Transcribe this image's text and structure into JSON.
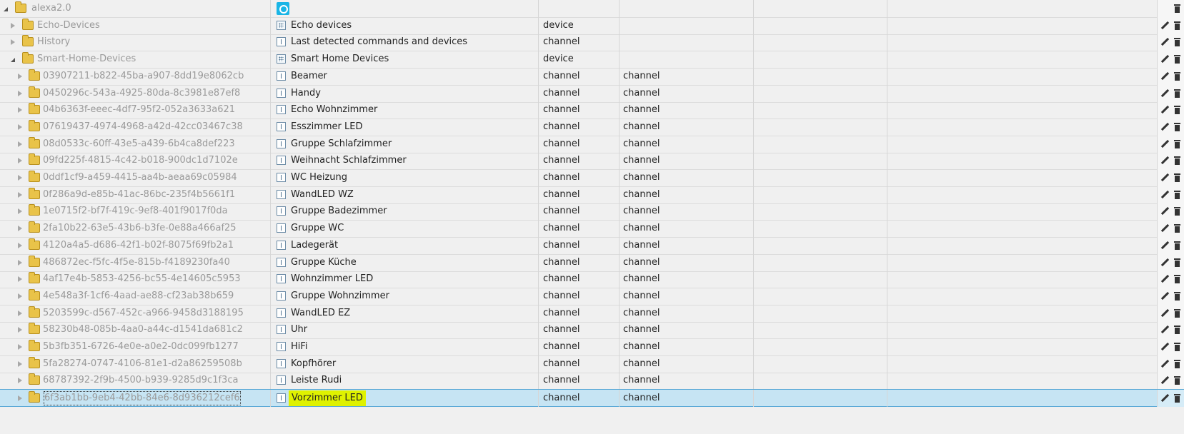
{
  "tree": {
    "rows": [
      {
        "id": "alexa2.0",
        "name": "",
        "icon": "echo-icon",
        "type": "",
        "role": "",
        "depth": 0,
        "expanded": true,
        "selected": false,
        "highlight": false,
        "actions": false
      },
      {
        "id": "Echo-Devices",
        "name": "Echo devices",
        "icon": "device-icon",
        "type": "device",
        "role": "",
        "depth": 1,
        "expanded": false,
        "selected": false,
        "highlight": false,
        "actions": true
      },
      {
        "id": "History",
        "name": "Last detected commands and devices",
        "icon": "channel-icon",
        "type": "channel",
        "role": "",
        "depth": 1,
        "expanded": false,
        "selected": false,
        "highlight": false,
        "actions": true
      },
      {
        "id": "Smart-Home-Devices",
        "name": "Smart Home Devices",
        "icon": "device-icon",
        "type": "device",
        "role": "",
        "depth": 1,
        "expanded": true,
        "selected": false,
        "highlight": false,
        "actions": true
      },
      {
        "id": "03907211-b822-45ba-a907-8dd19e8062cb",
        "name": "Beamer",
        "icon": "channel-icon",
        "type": "channel",
        "role": "channel",
        "depth": 2,
        "expanded": false,
        "selected": false,
        "highlight": false,
        "actions": true
      },
      {
        "id": "0450296c-543a-4925-80da-8c3981e87ef8",
        "name": "Handy",
        "icon": "channel-icon",
        "type": "channel",
        "role": "channel",
        "depth": 2,
        "expanded": false,
        "selected": false,
        "highlight": false,
        "actions": true
      },
      {
        "id": "04b6363f-eeec-4df7-95f2-052a3633a621",
        "name": "Echo Wohnzimmer",
        "icon": "channel-icon",
        "type": "channel",
        "role": "channel",
        "depth": 2,
        "expanded": false,
        "selected": false,
        "highlight": false,
        "actions": true
      },
      {
        "id": "07619437-4974-4968-a42d-42cc03467c38",
        "name": "Esszimmer LED",
        "icon": "channel-icon",
        "type": "channel",
        "role": "channel",
        "depth": 2,
        "expanded": false,
        "selected": false,
        "highlight": false,
        "actions": true
      },
      {
        "id": "08d0533c-60ff-43e5-a439-6b4ca8def223",
        "name": "Gruppe Schlafzimmer",
        "icon": "channel-icon",
        "type": "channel",
        "role": "channel",
        "depth": 2,
        "expanded": false,
        "selected": false,
        "highlight": false,
        "actions": true
      },
      {
        "id": "09fd225f-4815-4c42-b018-900dc1d7102e",
        "name": "Weihnacht Schlafzimmer",
        "icon": "channel-icon",
        "type": "channel",
        "role": "channel",
        "depth": 2,
        "expanded": false,
        "selected": false,
        "highlight": false,
        "actions": true
      },
      {
        "id": "0ddf1cf9-a459-4415-aa4b-aeaa69c05984",
        "name": "WC Heizung",
        "icon": "channel-icon",
        "type": "channel",
        "role": "channel",
        "depth": 2,
        "expanded": false,
        "selected": false,
        "highlight": false,
        "actions": true
      },
      {
        "id": "0f286a9d-e85b-41ac-86bc-235f4b5661f1",
        "name": "WandLED WZ",
        "icon": "channel-icon",
        "type": "channel",
        "role": "channel",
        "depth": 2,
        "expanded": false,
        "selected": false,
        "highlight": false,
        "actions": true
      },
      {
        "id": "1e0715f2-bf7f-419c-9ef8-401f9017f0da",
        "name": "Gruppe Badezimmer",
        "icon": "channel-icon",
        "type": "channel",
        "role": "channel",
        "depth": 2,
        "expanded": false,
        "selected": false,
        "highlight": false,
        "actions": true
      },
      {
        "id": "2fa10b22-63e5-43b6-b3fe-0e88a466af25",
        "name": "Gruppe WC",
        "icon": "channel-icon",
        "type": "channel",
        "role": "channel",
        "depth": 2,
        "expanded": false,
        "selected": false,
        "highlight": false,
        "actions": true
      },
      {
        "id": "4120a4a5-d686-42f1-b02f-8075f69fb2a1",
        "name": "Ladegerät",
        "icon": "channel-icon",
        "type": "channel",
        "role": "channel",
        "depth": 2,
        "expanded": false,
        "selected": false,
        "highlight": false,
        "actions": true
      },
      {
        "id": "486872ec-f5fc-4f5e-815b-f4189230fa40",
        "name": "Gruppe Küche",
        "icon": "channel-icon",
        "type": "channel",
        "role": "channel",
        "depth": 2,
        "expanded": false,
        "selected": false,
        "highlight": false,
        "actions": true
      },
      {
        "id": "4af17e4b-5853-4256-bc55-4e14605c5953",
        "name": "Wohnzimmer LED",
        "icon": "channel-icon",
        "type": "channel",
        "role": "channel",
        "depth": 2,
        "expanded": false,
        "selected": false,
        "highlight": false,
        "actions": true
      },
      {
        "id": "4e548a3f-1cf6-4aad-ae88-cf23ab38b659",
        "name": "Gruppe Wohnzimmer",
        "icon": "channel-icon",
        "type": "channel",
        "role": "channel",
        "depth": 2,
        "expanded": false,
        "selected": false,
        "highlight": false,
        "actions": true
      },
      {
        "id": "5203599c-d567-452c-a966-9458d3188195",
        "name": "WandLED EZ",
        "icon": "channel-icon",
        "type": "channel",
        "role": "channel",
        "depth": 2,
        "expanded": false,
        "selected": false,
        "highlight": false,
        "actions": true
      },
      {
        "id": "58230b48-085b-4aa0-a44c-d1541da681c2",
        "name": "Uhr",
        "icon": "channel-icon",
        "type": "channel",
        "role": "channel",
        "depth": 2,
        "expanded": false,
        "selected": false,
        "highlight": false,
        "actions": true
      },
      {
        "id": "5b3fb351-6726-4e0e-a0e2-0dc099fb1277",
        "name": "HiFi",
        "icon": "channel-icon",
        "type": "channel",
        "role": "channel",
        "depth": 2,
        "expanded": false,
        "selected": false,
        "highlight": false,
        "actions": true
      },
      {
        "id": "5fa28274-0747-4106-81e1-d2a86259508b",
        "name": "Kopfhörer",
        "icon": "channel-icon",
        "type": "channel",
        "role": "channel",
        "depth": 2,
        "expanded": false,
        "selected": false,
        "highlight": false,
        "actions": true
      },
      {
        "id": "68787392-2f9b-4500-b939-9285d9c1f3ca",
        "name": "Leiste Rudi",
        "icon": "channel-icon",
        "type": "channel",
        "role": "channel",
        "depth": 2,
        "expanded": false,
        "selected": false,
        "highlight": false,
        "actions": true
      },
      {
        "id": "6f3ab1bb-9eb4-42bb-84e6-8d936212cef6",
        "name": "Vorzimmer LED",
        "icon": "channel-icon",
        "type": "channel",
        "role": "channel",
        "depth": 2,
        "expanded": false,
        "selected": true,
        "highlight": true,
        "actions": true
      }
    ]
  },
  "icons": {
    "folder": "folder-icon",
    "edit": "edit-icon",
    "delete": "delete-icon"
  },
  "colors": {
    "selected_row": "#c6e4f3",
    "highlight": "#dff200",
    "echo_icon": "#19b5e6",
    "folder": "#e9c349"
  }
}
